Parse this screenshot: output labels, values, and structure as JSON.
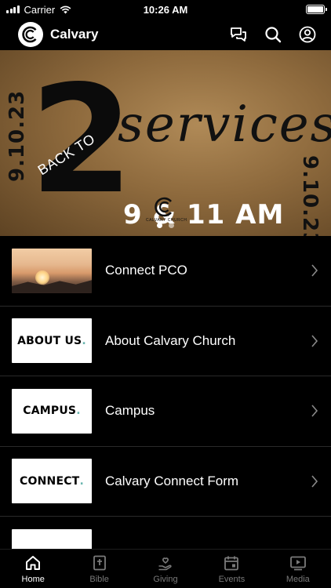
{
  "status_bar": {
    "carrier": "Carrier",
    "time": "10:26 AM"
  },
  "header": {
    "title": "Calvary"
  },
  "hero": {
    "date": "9.10.23",
    "back_to": "BACK TO",
    "number": "2",
    "services": "services",
    "times": "9 & 11 AM",
    "church_text": "CALVARY CHURCH",
    "slide_count": 2,
    "active_slide": 1
  },
  "list": [
    {
      "label": "Connect PCO",
      "thumb_text": "",
      "thumb_type": "photo"
    },
    {
      "label": "About Calvary Church",
      "thumb_text": "ABOUT US",
      "thumb_type": "text"
    },
    {
      "label": "Campus",
      "thumb_text": "CAMPUS",
      "thumb_type": "text"
    },
    {
      "label": "Calvary Connect Form",
      "thumb_text": "CONNECT",
      "thumb_type": "text"
    }
  ],
  "tabs": [
    {
      "label": "Home",
      "icon": "home-icon",
      "active": true
    },
    {
      "label": "Bible",
      "icon": "bible-icon",
      "active": false
    },
    {
      "label": "Giving",
      "icon": "giving-icon",
      "active": false
    },
    {
      "label": "Events",
      "icon": "events-icon",
      "active": false
    },
    {
      "label": "Media",
      "icon": "media-icon",
      "active": false
    }
  ],
  "colors": {
    "background": "#000000",
    "accent_dot": "#6bb6b0",
    "hero": "#8e6a3d",
    "inactive_tab": "#7a7a7a"
  }
}
